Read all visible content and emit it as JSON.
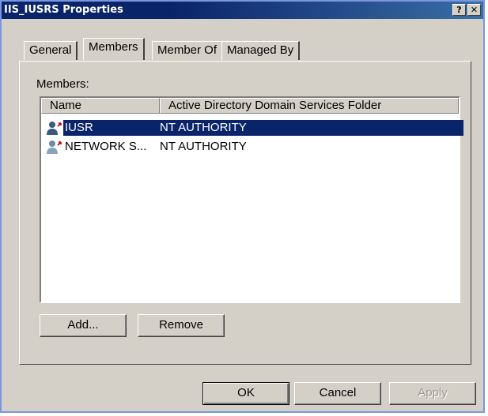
{
  "window": {
    "title": "IIS_IUSRS Properties",
    "help_label": "?",
    "close_label": "✕"
  },
  "tabs": [
    {
      "label": "General",
      "active": false
    },
    {
      "label": "Members",
      "active": true
    },
    {
      "label": "Member Of",
      "active": false
    },
    {
      "label": "Managed By",
      "active": false
    }
  ],
  "members": {
    "label": "Members:",
    "columns": [
      "Name",
      "Active Directory Domain Services Folder"
    ],
    "rows": [
      {
        "name": "IUSR",
        "folder": "NT AUTHORITY",
        "selected": true,
        "icon": "user-icon"
      },
      {
        "name": "NETWORK S...",
        "folder": "NT AUTHORITY",
        "selected": false,
        "icon": "user-icon"
      }
    ]
  },
  "buttons": {
    "add": "Add...",
    "remove": "Remove",
    "ok": "OK",
    "cancel": "Cancel",
    "apply": "Apply"
  },
  "colors": {
    "title_bar": "#0a246a",
    "selection": "#0a246a",
    "face": "#d4d0c8"
  }
}
